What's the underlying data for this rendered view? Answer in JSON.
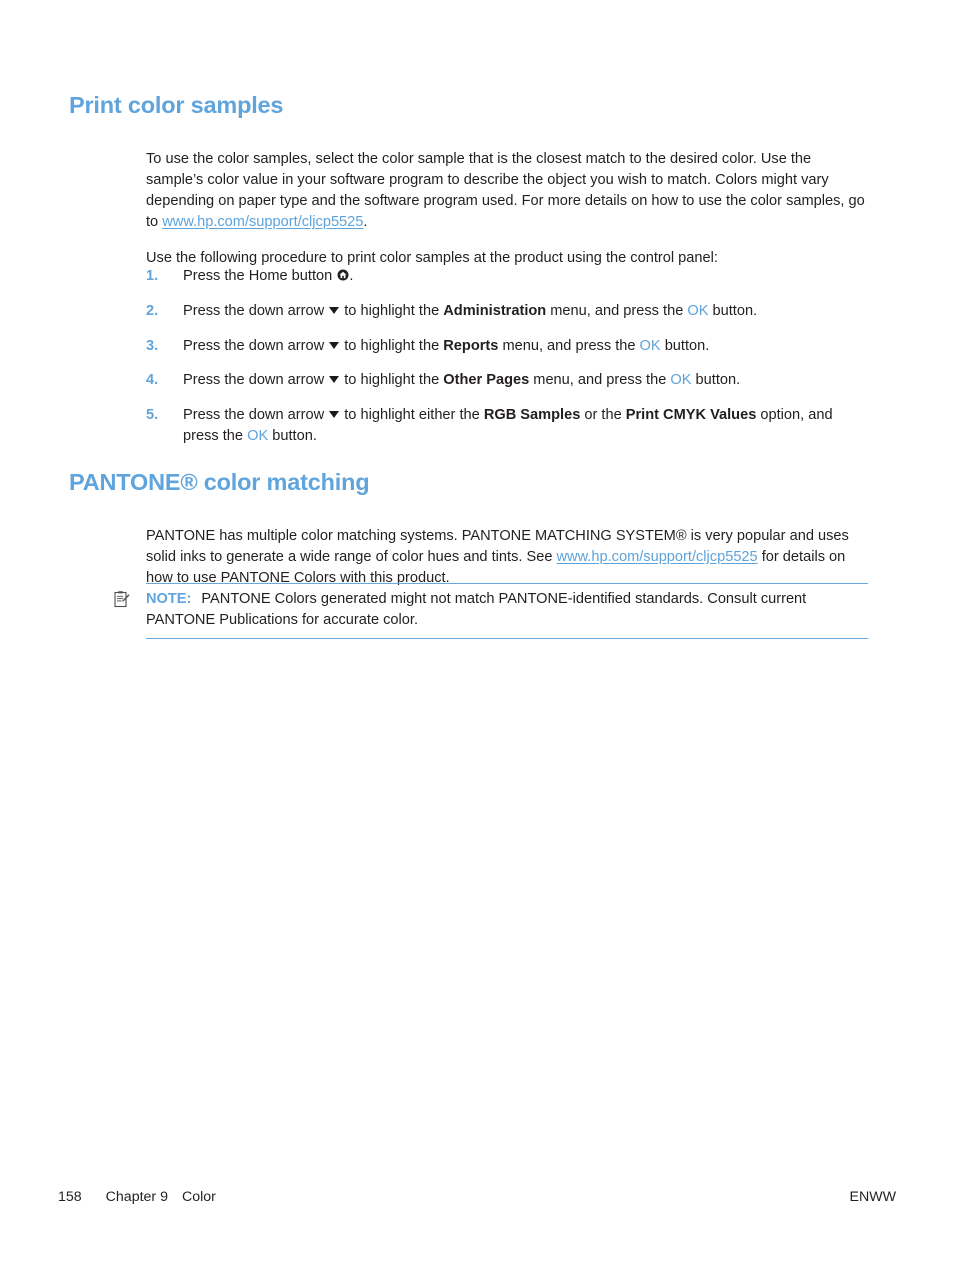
{
  "document": {
    "section1": {
      "heading": "Print color samples",
      "intro_part1": "To use the color samples, select the color sample that is the closest match to the desired color. Use the sample’s color value in your software program to describe the object you wish to match. Colors might vary depending on paper type and the software program used. For more details on how to use the color samples, go to ",
      "intro_link": "www.hp.com/support/cljcp5525",
      "intro_part2": ".",
      "procedure_lead": "Use the following procedure to print color samples at the product using the control panel:"
    },
    "procedure": {
      "steps": [
        {
          "marker": "1.",
          "text_before": "Press the Home button ",
          "icon": "home-button-icon",
          "text_after": "."
        },
        {
          "marker": "2.",
          "text_before": "Press the down arrow ",
          "icon": "down-arrow-icon",
          "text_mid1": " to highlight the ",
          "bold1": "Administration",
          "text_mid2": " menu, and press the ",
          "ok": "OK",
          "text_after": " button."
        },
        {
          "marker": "3.",
          "text_before": "Press the down arrow ",
          "icon": "down-arrow-icon",
          "text_mid1": " to highlight the ",
          "bold1": "Reports",
          "text_mid2": " menu, and press the ",
          "ok": "OK",
          "text_after": " button."
        },
        {
          "marker": "4.",
          "text_before": "Press the down arrow ",
          "icon": "down-arrow-icon",
          "text_mid1": " to highlight the ",
          "bold1": "Other Pages",
          "text_mid2": " menu, and press the ",
          "ok": "OK",
          "text_after": " button."
        },
        {
          "marker": "5.",
          "text_before": "Press the down arrow ",
          "icon": "down-arrow-icon",
          "text_mid1": " to highlight either the ",
          "bold1": "RGB Samples",
          "text_mid2": " or the ",
          "bold2": "Print CMYK Values",
          "text_mid3": " option, and press the ",
          "ok": "OK",
          "text_after": " button."
        }
      ]
    },
    "section2": {
      "heading": "PANTONE® color matching",
      "para_part1": "PANTONE has multiple color matching systems. PANTONE MATCHING SYSTEM® is very popular and uses solid inks to generate a wide range of color hues and tints. See ",
      "para_link": "www.hp.com/support/cljcp5525",
      "para_part2": " for details on how to use PANTONE Colors with this product."
    },
    "note": {
      "icon": "note-clipboard-icon",
      "label": "NOTE:",
      "text": "PANTONE Colors generated might not match PANTONE-identified standards. Consult current PANTONE Publications for accurate color."
    },
    "footer": {
      "page_number": "158",
      "chapter": "Chapter 9",
      "chapter_title": "Color",
      "right": "ENWW"
    },
    "colors": {
      "heading_blue": "#5fa4dc",
      "link_blue": "#5da3db",
      "body_black": "#231f20",
      "rule_blue": "#6aa9de"
    }
  }
}
